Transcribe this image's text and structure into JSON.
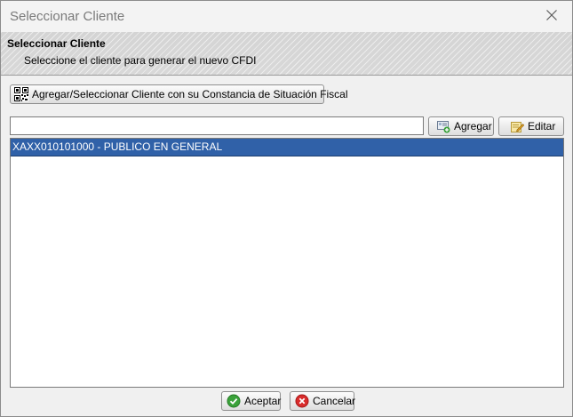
{
  "window": {
    "title": "Seleccionar Cliente"
  },
  "header": {
    "title": "Seleccionar Cliente",
    "subtitle": "Seleccione el cliente para generar el nuevo CFDI"
  },
  "toolbar": {
    "csf_button_label": "Agregar/Seleccionar Cliente con su Constancia de Situación Fiscal"
  },
  "search": {
    "value": "",
    "add_label": "Agregar",
    "edit_label": "Editar"
  },
  "clients": {
    "items": [
      {
        "label": "XAXX010101000 - PUBLICO EN GENERAL",
        "selected": true
      }
    ]
  },
  "footer": {
    "accept_label": "Aceptar",
    "cancel_label": "Cancelar"
  },
  "colors": {
    "selection": "#3061a8",
    "accept_icon": "#3aa23a",
    "cancel_icon": "#d92b2b"
  },
  "icons": {
    "close": "close-icon",
    "csf": "qr-code-icon",
    "add": "add-card-icon",
    "edit": "edit-pencil-icon",
    "accept": "check-circle-icon",
    "cancel": "cancel-circle-icon"
  }
}
